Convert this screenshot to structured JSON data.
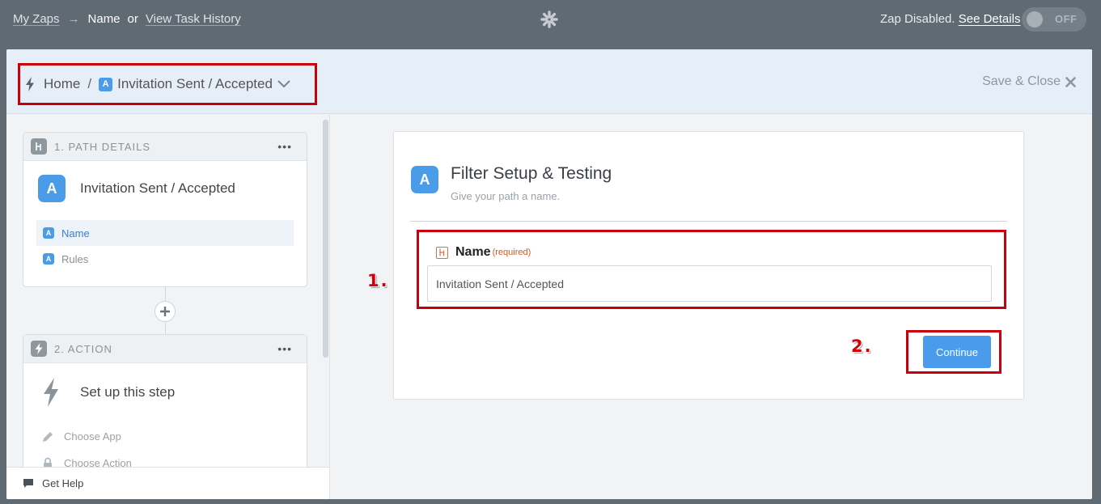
{
  "topbar": {
    "my_zaps": "My Zaps",
    "arrow": "→",
    "current": "Name",
    "or": "or",
    "view_history": "View Task History",
    "status_text": "Zap Disabled.",
    "see_details": "See Details",
    "toggle_label": "OFF"
  },
  "header": {
    "home": "Home",
    "sep": "/",
    "path_badge": "A",
    "path_name": "Invitation Sent / Accepted",
    "save_close": "Save & Close"
  },
  "sidebar": {
    "card1": {
      "header": "1. PATH DETAILS",
      "dots": "•••",
      "badge": "A",
      "title": "Invitation Sent / Accepted",
      "items": [
        {
          "badge": "A",
          "label": "Name"
        },
        {
          "badge": "A",
          "label": "Rules"
        }
      ]
    },
    "card2": {
      "header": "2. ACTION",
      "dots": "•••",
      "title": "Set up this step",
      "items": [
        {
          "label": "Choose App",
          "icon": "pencil-icon"
        },
        {
          "label": "Choose Action",
          "icon": "lock-icon"
        }
      ]
    },
    "get_help": "Get Help"
  },
  "panel": {
    "badge": "A",
    "title": "Filter Setup & Testing",
    "subtitle": "Give your path a name.",
    "field_label": "Name",
    "field_required": "(required)",
    "field_value": "Invitation Sent / Accepted",
    "continue": "Continue"
  },
  "annotations": {
    "one": "1.",
    "two": "2."
  },
  "colors": {
    "topbar": "#5f6a72",
    "accent": "#4a9be8",
    "highlight": "#c9000a"
  }
}
